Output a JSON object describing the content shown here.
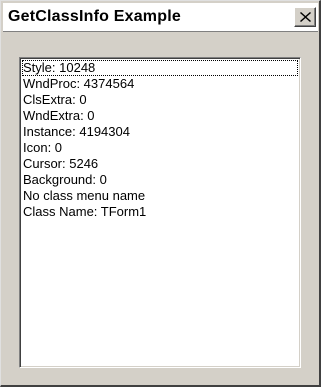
{
  "window": {
    "title": "GetClassInfo Example",
    "close_icon": "close-x"
  },
  "listbox": {
    "items": [
      "Style: 10248",
      "WndProc: 4374564",
      "ClsExtra: 0",
      "WndExtra: 0",
      "Instance: 4194304",
      "Icon: 0",
      "Cursor: 5246",
      "Background: 0",
      "No class menu name",
      "Class Name: TForm1"
    ],
    "focused_index": 0
  }
}
